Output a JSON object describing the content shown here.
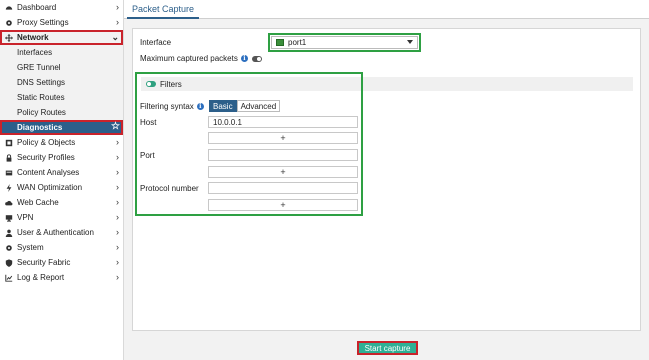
{
  "sidebar": {
    "items": [
      {
        "label": "Dashboard",
        "icon": "dashboard-icon"
      },
      {
        "label": "Proxy Settings",
        "icon": "gear-icon"
      },
      {
        "label": "Network",
        "icon": "network-icon"
      },
      {
        "label": "Interfaces"
      },
      {
        "label": "GRE Tunnel"
      },
      {
        "label": "DNS Settings"
      },
      {
        "label": "Static Routes"
      },
      {
        "label": "Policy Routes"
      },
      {
        "label": "Diagnostics"
      },
      {
        "label": "Policy & Objects",
        "icon": "policy-icon"
      },
      {
        "label": "Security Profiles",
        "icon": "lock-icon"
      },
      {
        "label": "Content Analyses",
        "icon": "content-icon"
      },
      {
        "label": "WAN Optimization",
        "icon": "wan-icon"
      },
      {
        "label": "Web Cache",
        "icon": "cloud-icon"
      },
      {
        "label": "VPN",
        "icon": "monitor-icon"
      },
      {
        "label": "User & Authentication",
        "icon": "user-icon"
      },
      {
        "label": "System",
        "icon": "gear-icon"
      },
      {
        "label": "Security Fabric",
        "icon": "shield-icon"
      },
      {
        "label": "Log & Report",
        "icon": "chart-icon"
      }
    ]
  },
  "main": {
    "tab": "Packet Capture",
    "interface_label": "Interface",
    "interface_value": "port1",
    "max_packets_label": "Maximum captured packets",
    "filters_label": "Filters",
    "filtering_syntax_label": "Filtering syntax",
    "syntax_options": [
      "Basic",
      "Advanced"
    ],
    "host_label": "Host",
    "host_value": "10.0.0.1",
    "port_label": "Port",
    "protocol_label": "Protocol number",
    "add_symbol": "+",
    "start_button": "Start capture"
  },
  "colors": {
    "accent": "#2c5f8a",
    "highlight_red": "#c9232b",
    "highlight_green": "#2ea043",
    "start_button": "#2eb095"
  }
}
